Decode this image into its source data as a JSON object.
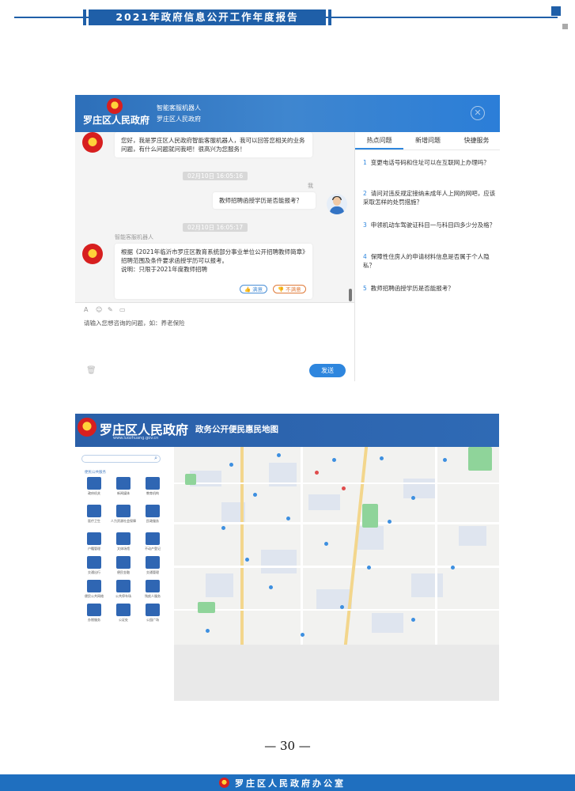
{
  "header": {
    "title": "2021年政府信息公开工作年度报告"
  },
  "robot": {
    "gov_name": "罗庄区人民政府",
    "robot_name": "智能客服机器人",
    "org_name": "罗庄区人民政府",
    "welcome": "您好，我是罗庄区人民政府智能客服机器人，我可以回答您相关的业务问题，有什么问题就问我吧！很高兴为您服务！",
    "time1": "02月10日 16:05:16",
    "me_label": "我",
    "user_question": "教师招聘函授学历是否能报考？",
    "time2": "02月10日 16:05:17",
    "bot_label": "智能客服机器人",
    "answer": "根据《2021年临沂市罗庄区教育系统部分事业单位公开招聘教师简章》招聘范围及条件要求函授学历可以报考。\n说明：只限于2021年度教师招聘",
    "satisfied": "满意",
    "unsatisfied": "不满意",
    "input_placeholder": "请输入您想咨询的问题，如：养老保险",
    "send": "发送",
    "tabs": [
      "热点问题",
      "新增问题",
      "快捷服务"
    ],
    "questions": [
      {
        "num": "1",
        "text": "变更电话号码和住址可以在互联网上办理吗？"
      },
      {
        "num": "2",
        "text": "请问对违反规定接纳未成年人上网的网吧，应该采取怎样的处罚措施？"
      },
      {
        "num": "3",
        "text": "申领机动车驾驶证科目一与科目四多少分及格？"
      },
      {
        "num": "4",
        "text": "保障性住房人的申请材料信息是否属于个人隐私？"
      },
      {
        "num": "5",
        "text": "教师招聘函授学历是否能报考？"
      }
    ]
  },
  "map": {
    "gov_name": "罗庄区人民政府",
    "url": "www.luozhuang.gov.cn",
    "title": "政务公开便民惠民地图",
    "categories_title": "便民公共服务",
    "categories": [
      {
        "label": "政府机关",
        "icon": "building-icon"
      },
      {
        "label": "新闻媒体",
        "icon": "news-icon"
      },
      {
        "label": "教育机构",
        "icon": "graduation-icon"
      },
      {
        "label": "医疗卫生",
        "icon": "medical-icon"
      },
      {
        "label": "人力资源社会保障",
        "icon": "hr-icon"
      },
      {
        "label": "民政服务",
        "icon": "civil-icon"
      },
      {
        "label": "户籍管理",
        "icon": "household-icon"
      },
      {
        "label": "文体场馆",
        "icon": "sports-icon"
      },
      {
        "label": "不动产登记",
        "icon": "realestate-icon"
      },
      {
        "label": "交通出行",
        "icon": "bus-icon"
      },
      {
        "label": "便民金融",
        "icon": "finance-icon"
      },
      {
        "label": "交通管理",
        "icon": "traffic-light-icon"
      },
      {
        "label": "便民公共网络",
        "icon": "network-icon"
      },
      {
        "label": "公共停车场",
        "icon": "parking-icon"
      },
      {
        "label": "残疾人服务",
        "icon": "wheelchair-icon"
      },
      {
        "label": "办税服务",
        "icon": "tax-icon"
      },
      {
        "label": "公证处",
        "icon": "notary-icon"
      },
      {
        "label": "公园广场",
        "icon": "park-icon"
      }
    ]
  },
  "footer": {
    "page_number": "— 30 —",
    "office": "罗庄区人民政府办公室"
  }
}
